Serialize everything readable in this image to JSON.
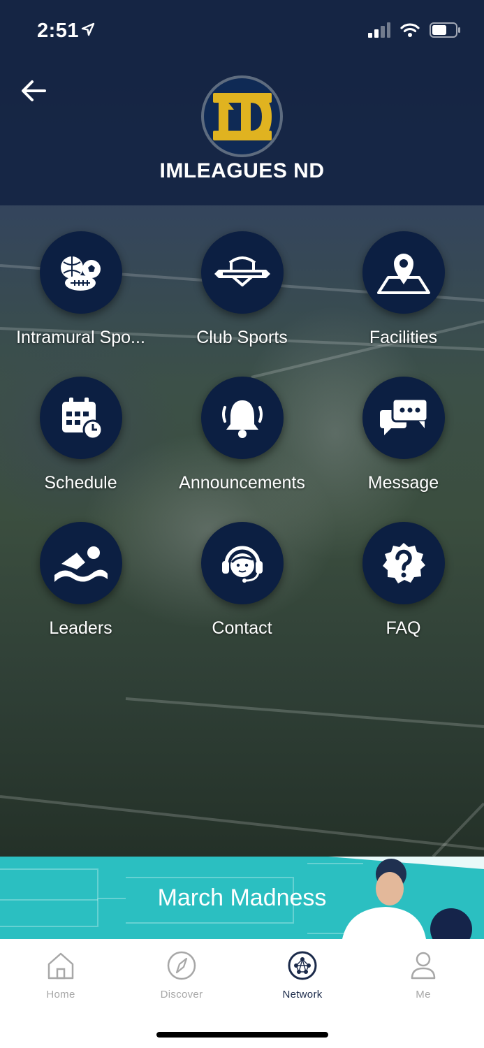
{
  "status_bar": {
    "time": "2:51"
  },
  "header": {
    "title": "IMLEAGUES ND"
  },
  "menu": [
    {
      "label": "Intramural Spo...",
      "icon": "sports-balls-icon"
    },
    {
      "label": "Club Sports",
      "icon": "club-banner-icon"
    },
    {
      "label": "Facilities",
      "icon": "map-pin-icon"
    },
    {
      "label": "Schedule",
      "icon": "calendar-clock-icon"
    },
    {
      "label": "Announcements",
      "icon": "bell-icon"
    },
    {
      "label": "Message",
      "icon": "chat-bubbles-icon"
    },
    {
      "label": "Leaders",
      "icon": "swimmer-icon"
    },
    {
      "label": "Contact",
      "icon": "headset-agent-icon"
    },
    {
      "label": "FAQ",
      "icon": "question-icon"
    }
  ],
  "banner": {
    "text": "March Madness"
  },
  "tabs": [
    {
      "label": "Home",
      "icon": "home-icon"
    },
    {
      "label": "Discover",
      "icon": "compass-icon"
    },
    {
      "label": "Network",
      "icon": "network-icon",
      "active": true
    },
    {
      "label": "Me",
      "icon": "person-icon"
    }
  ],
  "colors": {
    "header_bg": "#122242",
    "circle_bg": "#0c1f42",
    "banner_bg": "#2bbfc1",
    "logo_gold": "#e0b320",
    "tab_active": "#1b2a4a",
    "tab_inactive": "#a7a7a7"
  }
}
